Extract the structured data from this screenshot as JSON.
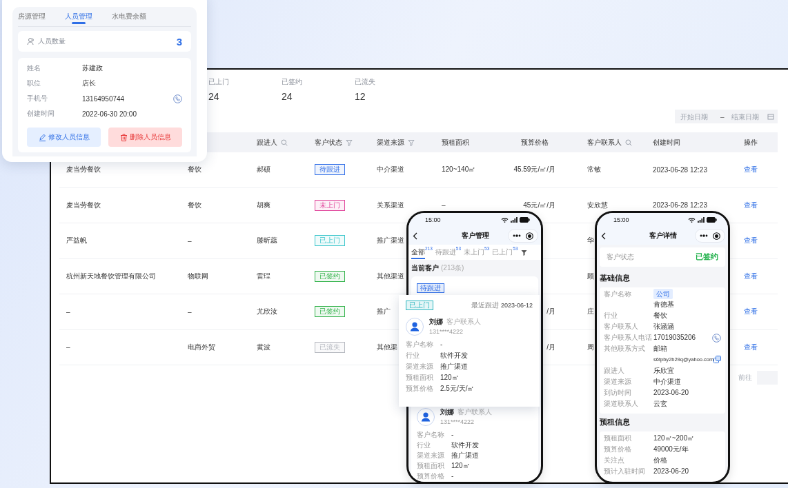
{
  "staff_card": {
    "tabs": [
      {
        "label": "房源管理",
        "selected": false
      },
      {
        "label": "人员管理",
        "selected": true
      },
      {
        "label": "水电费余额",
        "selected": false
      }
    ],
    "count": {
      "label": "人员数量",
      "value": "3"
    },
    "fields": [
      {
        "label": "姓名",
        "value": "苏建政"
      },
      {
        "label": "职位",
        "value": "店长"
      },
      {
        "label": "手机号",
        "value": "13164950744",
        "kind": "phone"
      },
      {
        "label": "创建时间",
        "value": "2022-06-30 20:00"
      }
    ],
    "buttons": [
      {
        "label": "修改人员信息",
        "kind": "edit"
      },
      {
        "label": "删除人员信息",
        "kind": "delete"
      }
    ]
  },
  "dashboard": {
    "stats": [
      {
        "label": "已上门",
        "value": "24"
      },
      {
        "label": "已签约",
        "value": "24"
      },
      {
        "label": "已流失",
        "value": "12"
      }
    ],
    "date_range": {
      "start_placeholder": "开始日期",
      "separator": "–",
      "end_placeholder": "结束日期"
    },
    "table": {
      "columns": [
        null,
        null,
        {
          "label": "跟进人",
          "kind": "searchable"
        },
        {
          "label": "客户状态",
          "kind": "filterable"
        },
        {
          "label": "渠道来源",
          "kind": "filterable"
        },
        {
          "label": "预租面积"
        },
        {
          "label": "预算价格"
        },
        {
          "label": "客户联系人",
          "kind": "searchable"
        },
        {
          "label": "创建时间"
        },
        {
          "label": "操作"
        }
      ],
      "rows": [
        {
          "customer": "麦当劳餐饮",
          "industry": "餐饮",
          "follower": "郝硕",
          "status": {
            "label": "待跟进",
            "color": "#3370e8"
          },
          "channel": "中介渠道",
          "area": "120~140㎡",
          "price": "45.59元/㎡/月",
          "contact": "常敏",
          "created": "2023-06-28 12:23",
          "action": "查看"
        },
        {
          "customer": "麦当劳餐饮",
          "industry": "餐饮",
          "follower": "胡爽",
          "status": {
            "label": "未上门",
            "color": "#e0449a"
          },
          "channel": "关系渠道",
          "area": "–",
          "price": "45元/㎡/月",
          "contact": "安欣慧",
          "created": "2023-06-28 12:23",
          "action": "查看"
        },
        {
          "customer": "严益帆",
          "industry": "–",
          "follower": "滕昕蕊",
          "status": {
            "label": "已上门",
            "color": "#3cc6cc"
          },
          "channel": "推广渠道",
          "contact": "华",
          "action": "查看"
        },
        {
          "customer": "杭州新天地餐饮管理有限公司",
          "industry": "物联网",
          "follower": "雷珵",
          "status": {
            "label": "已签约",
            "color": "#32b24a"
          },
          "channel": "其他渠道",
          "contact": "顾",
          "action": "查看"
        },
        {
          "customer": "–",
          "industry": "–",
          "follower": "尤欣汝",
          "status": {
            "label": "已签约",
            "color": "#32b24a"
          },
          "channel": "推广",
          "price": "/月",
          "contact": "庄",
          "action": "查看"
        },
        {
          "customer": "–",
          "industry": "电商外贸",
          "follower": "黄波",
          "status": {
            "label": "已流失",
            "color": "#b5b8bf"
          },
          "channel": "其他渠",
          "price": "/月",
          "contact": "周",
          "action": "查看"
        }
      ]
    },
    "pagination": {
      "goto_label": "前往"
    }
  },
  "phone_list": {
    "time": "15:00",
    "title": "客户管理",
    "tabs": [
      {
        "label": "全部",
        "count": "213",
        "selected": true
      },
      {
        "label": "待跟进",
        "count": "53",
        "selected": false
      },
      {
        "label": "未上门",
        "count": "53",
        "selected": false
      },
      {
        "label": "已上门",
        "count": "53",
        "selected": false
      }
    ],
    "section": {
      "title": "当前客户",
      "count": "(213条)"
    },
    "cards": [
      {
        "tag": {
          "label": "待跟进",
          "color": "#3370e8"
        }
      },
      {
        "contact": {
          "name": "刘娜",
          "role": "客户联系人",
          "phone": "131****4222"
        },
        "fields": [
          {
            "label": "客户名称",
            "value": "-"
          },
          {
            "label": "行业",
            "value": "软件开发"
          },
          {
            "label": "渠道来源",
            "value": "推广渠道"
          },
          {
            "label": "预租面积",
            "value": "120㎡"
          },
          {
            "label": "预算价格",
            "value": "-"
          }
        ]
      }
    ]
  },
  "popup_card": {
    "tag": {
      "label": "已上门",
      "color": "#2bb6bf"
    },
    "follow_label": "最近跟进",
    "follow_date": "2023-06-12",
    "contact": {
      "name": "刘娜",
      "role": "客户联系人",
      "phone": "131****4222"
    },
    "fields": [
      {
        "label": "客户名称",
        "value": "-"
      },
      {
        "label": "行业",
        "value": "软件开发"
      },
      {
        "label": "渠道来源",
        "value": "推广渠道"
      },
      {
        "label": "预租面积",
        "value": "120㎡"
      },
      {
        "label": "预算价格",
        "value": "2.5元/天/㎡"
      }
    ]
  },
  "phone_detail": {
    "time": "15:00",
    "title": "客户详情",
    "status": {
      "label": "客户状态",
      "value": "已签约"
    },
    "sections": [
      {
        "title": "基础信息",
        "fields": [
          {
            "label": "客户名称",
            "tag": "公司",
            "value": "肯德基"
          },
          {
            "label": "行业",
            "value": "餐饮"
          },
          {
            "label": "客户联系人",
            "value": "张涵涵"
          },
          {
            "label": "客户联系人电话",
            "value": "17019035206",
            "kind": "phone"
          },
          {
            "label": "其他联系方式",
            "value": "邮箱",
            "extra": "s6tpby2b29q@yahoo.com",
            "kind": "email"
          },
          {
            "label": "跟进人",
            "value": "乐欣宜"
          },
          {
            "label": "渠道来源",
            "value": "中介渠道"
          },
          {
            "label": "到访时间",
            "value": "2023-06-20"
          },
          {
            "label": "渠道联系人",
            "value": "云玄"
          }
        ]
      },
      {
        "title": "预租信息",
        "fields": [
          {
            "label": "预租面积",
            "value": "120㎡~200㎡"
          },
          {
            "label": "预算价格",
            "value": "49000元/年"
          },
          {
            "label": "关注点",
            "value": "价格"
          },
          {
            "label": "预计入驻时间",
            "value": "2023-06-20"
          }
        ]
      }
    ]
  }
}
